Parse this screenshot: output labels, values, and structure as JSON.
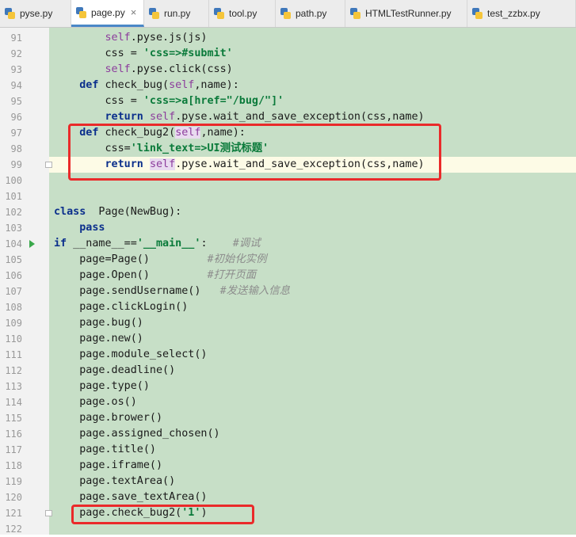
{
  "tabs": [
    {
      "label": "pyse.py",
      "active": false
    },
    {
      "label": "page.py",
      "active": true
    },
    {
      "label": "run.py",
      "active": false
    },
    {
      "label": "tool.py",
      "active": false
    },
    {
      "label": "path.py",
      "active": false
    },
    {
      "label": "HTMLTestRunner.py",
      "active": false
    },
    {
      "label": "test_zzbx.py",
      "active": false
    }
  ],
  "close_glyph": "×",
  "lines": [
    {
      "n": "91",
      "segs": [
        [
          "        ",
          ""
        ],
        [
          "self",
          "slf"
        ],
        [
          ".pyse.js(js)",
          ""
        ]
      ]
    },
    {
      "n": "92",
      "segs": [
        [
          "        css = ",
          ""
        ],
        [
          "'css=>#submit'",
          "str"
        ]
      ]
    },
    {
      "n": "93",
      "segs": [
        [
          "        ",
          ""
        ],
        [
          "self",
          "slf"
        ],
        [
          ".pyse.click(css)",
          ""
        ]
      ]
    },
    {
      "n": "94",
      "segs": [
        [
          "    ",
          ""
        ],
        [
          "def",
          "kw"
        ],
        [
          " check_bug(",
          ""
        ],
        [
          "self",
          "slf"
        ],
        [
          ",name):",
          ""
        ]
      ]
    },
    {
      "n": "95",
      "segs": [
        [
          "        css = ",
          ""
        ],
        [
          "'css=>a[href=\"/bug/\"]'",
          "str"
        ]
      ]
    },
    {
      "n": "96",
      "segs": [
        [
          "        ",
          ""
        ],
        [
          "return",
          "kw"
        ],
        [
          " ",
          ""
        ],
        [
          "self",
          "slf"
        ],
        [
          ".pyse.wait_and_save_exception(css,name)",
          ""
        ]
      ]
    },
    {
      "n": "97",
      "segs": [
        [
          "    ",
          ""
        ],
        [
          "def",
          "kw"
        ],
        [
          " check_bug2(",
          ""
        ],
        [
          "self",
          "slf slfbox"
        ],
        [
          ",name):",
          ""
        ]
      ]
    },
    {
      "n": "98",
      "segs": [
        [
          "        css=",
          ""
        ],
        [
          "'link_text=>UI测试标题'",
          "str"
        ]
      ]
    },
    {
      "n": "99",
      "segs": [
        [
          "        ",
          ""
        ],
        [
          "return",
          "kw"
        ],
        [
          " ",
          ""
        ],
        [
          "self",
          "slf slfbox"
        ],
        [
          ".pyse.wait_and_save_exception(css,name)",
          ""
        ]
      ]
    },
    {
      "n": "100",
      "segs": []
    },
    {
      "n": "101",
      "segs": []
    },
    {
      "n": "102",
      "segs": [
        [
          "class",
          "kw"
        ],
        [
          "  Page(NewBug):",
          ""
        ]
      ]
    },
    {
      "n": "103",
      "segs": [
        [
          "    ",
          ""
        ],
        [
          "pass",
          "kw"
        ]
      ]
    },
    {
      "n": "104",
      "segs": [
        [
          "if",
          "kw"
        ],
        [
          " __name__==",
          ""
        ],
        [
          "'__main__'",
          "str"
        ],
        [
          ":    ",
          ""
        ],
        [
          "#调试",
          "cmt"
        ]
      ]
    },
    {
      "n": "105",
      "segs": [
        [
          "    page=Page()         ",
          ""
        ],
        [
          "#初始化实例",
          "cmt"
        ]
      ]
    },
    {
      "n": "106",
      "segs": [
        [
          "    page.Open()         ",
          ""
        ],
        [
          "#打开页面",
          "cmt"
        ]
      ]
    },
    {
      "n": "107",
      "segs": [
        [
          "    page.sendUsername()   ",
          ""
        ],
        [
          "#发送输入信息",
          "cmt"
        ]
      ]
    },
    {
      "n": "108",
      "segs": [
        [
          "    page.clickLogin()",
          ""
        ]
      ]
    },
    {
      "n": "109",
      "segs": [
        [
          "    page.bug()",
          ""
        ]
      ]
    },
    {
      "n": "110",
      "segs": [
        [
          "    page.new()",
          ""
        ]
      ]
    },
    {
      "n": "111",
      "segs": [
        [
          "    page.module_select()",
          ""
        ]
      ]
    },
    {
      "n": "112",
      "segs": [
        [
          "    page.deadline()",
          ""
        ]
      ]
    },
    {
      "n": "113",
      "segs": [
        [
          "    page.type()",
          ""
        ]
      ]
    },
    {
      "n": "114",
      "segs": [
        [
          "    page.os()",
          ""
        ]
      ]
    },
    {
      "n": "115",
      "segs": [
        [
          "    page.brower()",
          ""
        ]
      ]
    },
    {
      "n": "116",
      "segs": [
        [
          "    page.assigned_chosen()",
          ""
        ]
      ]
    },
    {
      "n": "117",
      "segs": [
        [
          "    page.title()",
          ""
        ]
      ]
    },
    {
      "n": "118",
      "segs": [
        [
          "    page.iframe()",
          ""
        ]
      ]
    },
    {
      "n": "119",
      "segs": [
        [
          "    page.textArea()",
          ""
        ]
      ]
    },
    {
      "n": "120",
      "segs": [
        [
          "    page.save_textArea()",
          ""
        ]
      ]
    },
    {
      "n": "121",
      "segs": [
        [
          "    page.check_bug2(",
          ""
        ],
        [
          "'1'",
          "str"
        ],
        [
          ")",
          ""
        ]
      ]
    },
    {
      "n": "122",
      "segs": []
    }
  ],
  "current_line": "99",
  "run_marker_line": "104",
  "fold_lines": [
    "99",
    "121"
  ],
  "highlight_color": "#ea2a2a"
}
